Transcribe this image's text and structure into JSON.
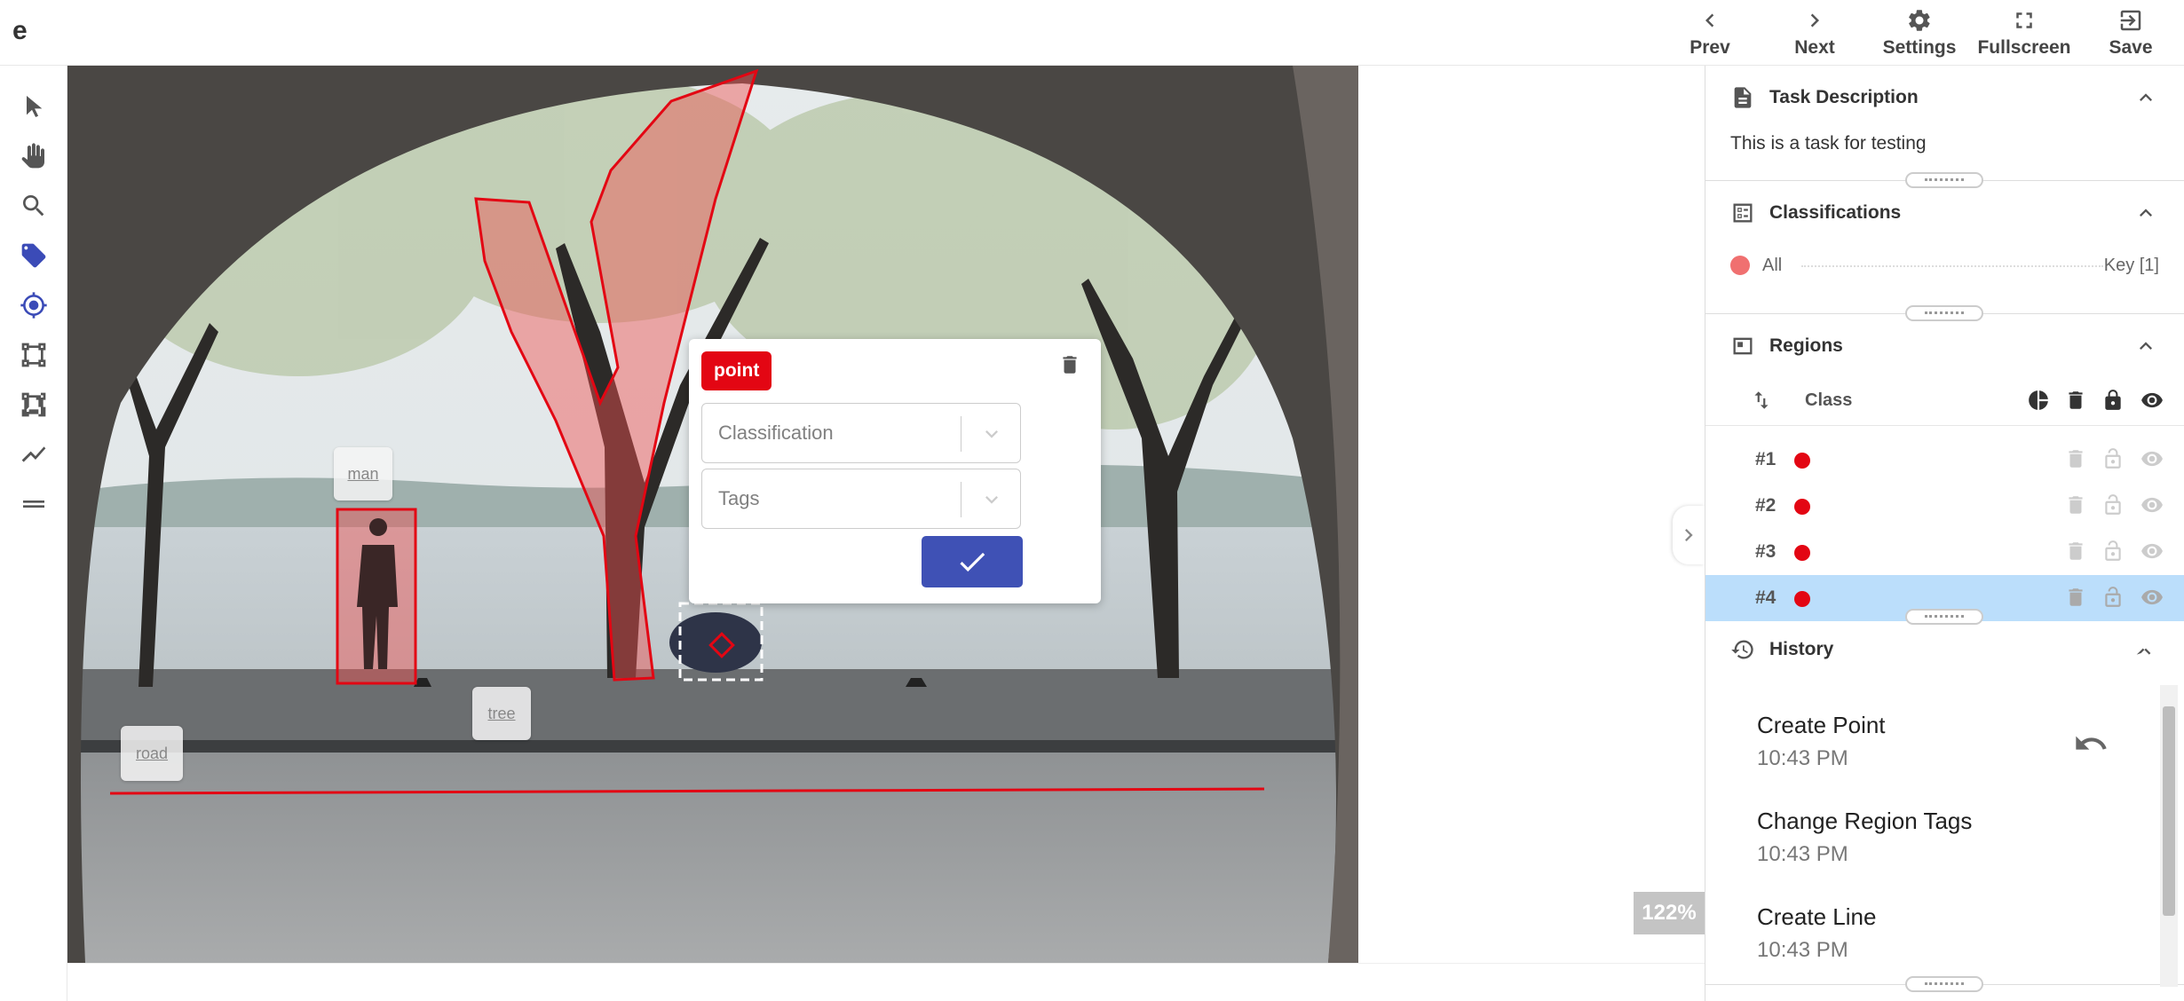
{
  "app": {
    "logo": "e"
  },
  "header": {
    "buttons": [
      {
        "id": "prev",
        "label": "Prev",
        "icon": "chevron-left-icon"
      },
      {
        "id": "next",
        "label": "Next",
        "icon": "chevron-right-icon"
      },
      {
        "id": "settings",
        "label": "Settings",
        "icon": "gear-icon"
      },
      {
        "id": "fullscreen",
        "label": "Fullscreen",
        "icon": "fullscreen-icon"
      },
      {
        "id": "save",
        "label": "Save",
        "icon": "exit-to-app-icon"
      }
    ]
  },
  "toolbar": {
    "tools": [
      {
        "name": "select",
        "icon": "cursor-icon"
      },
      {
        "name": "pan",
        "icon": "hand-icon"
      },
      {
        "name": "zoom",
        "icon": "search-icon"
      },
      {
        "name": "tag",
        "icon": "tag-icon",
        "active": true
      },
      {
        "name": "point",
        "icon": "crosshair-icon",
        "active": true
      },
      {
        "name": "box",
        "icon": "bounding-box-icon"
      },
      {
        "name": "polygon",
        "icon": "polygon-icon"
      },
      {
        "name": "line",
        "icon": "line-chart-icon"
      },
      {
        "name": "menu",
        "icon": "menu-icon"
      }
    ]
  },
  "canvas": {
    "zoom": "122%",
    "region_tags": [
      "man",
      "tree",
      "road"
    ]
  },
  "region_popup": {
    "type_label": "point",
    "classification_placeholder": "Classification",
    "tags_placeholder": "Tags"
  },
  "panels": {
    "task_description": {
      "title": "Task Description",
      "text": "This is a task for testing"
    },
    "classifications": {
      "title": "Classifications",
      "item": "All",
      "key": "Key [1]",
      "dot_color": "#f07070"
    },
    "regions": {
      "title": "Regions",
      "column_class": "Class",
      "rows": [
        {
          "id": "#1",
          "selected": false
        },
        {
          "id": "#2",
          "selected": false
        },
        {
          "id": "#3",
          "selected": false
        },
        {
          "id": "#4",
          "selected": true
        }
      ],
      "dot_color": "#e30613",
      "selected_color": "#bbdefb"
    },
    "history": {
      "title": "History",
      "items": [
        {
          "name": "Create Point",
          "time": "10:43 PM"
        },
        {
          "name": "Change Region Tags",
          "time": "10:43 PM"
        },
        {
          "name": "Create Line",
          "time": "10:43 PM"
        }
      ]
    }
  },
  "colors": {
    "accent": "#3f51b5",
    "region_red": "#e30613"
  }
}
